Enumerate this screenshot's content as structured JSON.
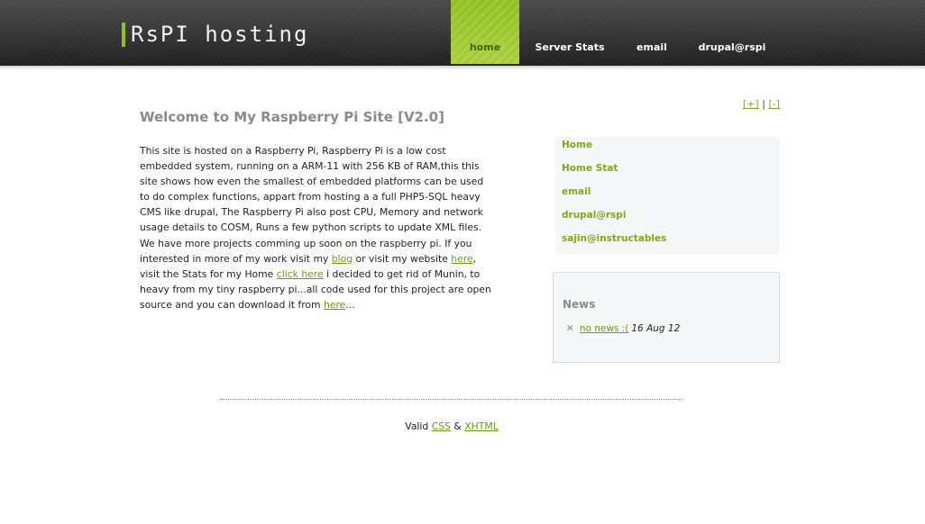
{
  "site": {
    "brand": "RsPI hosting"
  },
  "nav": {
    "home": "home",
    "server_stats": "Server Stats",
    "email": "email",
    "drupal": "drupal@rspi"
  },
  "main": {
    "title": "Welcome to My Raspberry Pi Site [V2.0]",
    "intro_text_1": "This site is hosted on a Raspberry Pi, Raspberry Pi is a low cost embedded system, running on a ARM-11 with 256 KB of RAM,this this site shows how even the smallest of embedded platforms can be used to do complex functions, appart from hosting a a full PHP5-SQL heavy CMS like drupal, The Raspberry Pi also post CPU, Memory and network usage details to COSM, Runs a few python scripts to update XML files. We have more projects comming up soon on the raspberry pi. If you interested in more of my work visit my ",
    "link_blog": "blog",
    "intro_text_2": " or visit my website ",
    "link_here_1": "here",
    "intro_text_3": ", visit the Stats for my Home ",
    "link_click_here": "click here",
    "intro_text_4": " i decided to get rid of Munin, to heavy from my tiny raspberry pi...all code used for this project are open source and you can download it from ",
    "link_here_2": "here",
    "intro_text_5": "..."
  },
  "text_size": {
    "increase": "[+]",
    "separator": "|",
    "decrease": "[-]"
  },
  "sidebar": {
    "items": [
      {
        "label": "Home"
      },
      {
        "label": "Home Stat"
      },
      {
        "label": "email"
      },
      {
        "label": "drupal@rspi"
      },
      {
        "label": "sajin@instructables"
      }
    ]
  },
  "news": {
    "title": "News",
    "items": [
      {
        "icon": "close-icon",
        "link": "no news :(",
        "date": "16 Aug 12"
      }
    ]
  },
  "footer": {
    "prefix": "Valid",
    "css": "CSS",
    "amp": "&",
    "xhtml": "XHTML"
  },
  "colors": {
    "accent": "#8ec21d",
    "link": "#6e9a10",
    "header_dark": "#2a2a2a"
  }
}
